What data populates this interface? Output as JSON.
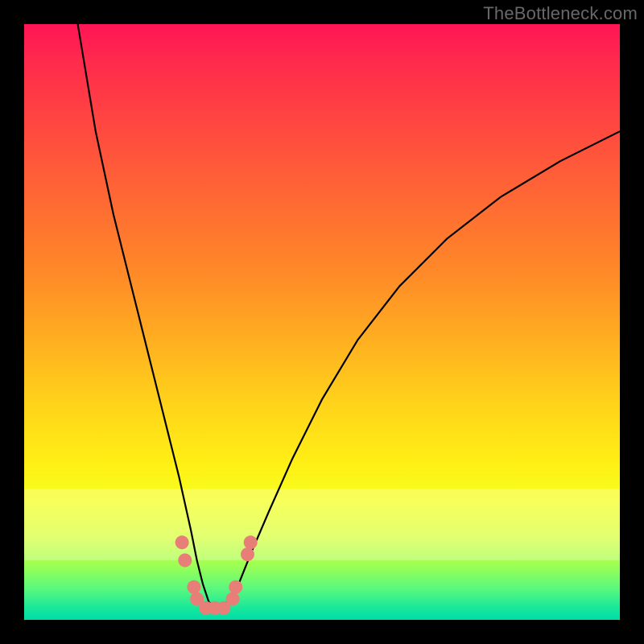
{
  "watermark": "TheBottleneck.com",
  "colors": {
    "frame": "#000000",
    "gradient_top": "#ff1555",
    "gradient_mid1": "#ff8a28",
    "gradient_mid2": "#fff015",
    "gradient_bottom": "#00dca9",
    "curve_stroke": "#000000",
    "marker_fill": "#e77f78",
    "watermark_text": "#686868"
  },
  "chart_data": {
    "type": "line",
    "title": "",
    "xlabel": "",
    "ylabel": "",
    "xlim": [
      0,
      100
    ],
    "ylim": [
      0,
      100
    ],
    "series": [
      {
        "name": "bottleneck-curve",
        "x": [
          9,
          12,
          15,
          18,
          20,
          22,
          24,
          26,
          28,
          29,
          30,
          31,
          32,
          33,
          34,
          36,
          38,
          41,
          45,
          50,
          56,
          63,
          71,
          80,
          90,
          100
        ],
        "y": [
          100,
          82,
          68,
          56,
          48,
          40,
          32,
          24,
          15,
          10,
          6,
          3,
          2,
          2,
          3,
          6,
          11,
          18,
          27,
          37,
          47,
          56,
          64,
          71,
          77,
          82
        ]
      }
    ],
    "markers": [
      {
        "x": 26.5,
        "y": 13
      },
      {
        "x": 27.0,
        "y": 10
      },
      {
        "x": 28.5,
        "y": 5.5
      },
      {
        "x": 29.0,
        "y": 3.5
      },
      {
        "x": 30.5,
        "y": 2.0
      },
      {
        "x": 32.0,
        "y": 2.0
      },
      {
        "x": 33.5,
        "y": 2.0
      },
      {
        "x": 35.0,
        "y": 3.5
      },
      {
        "x": 35.5,
        "y": 5.5
      },
      {
        "x": 37.5,
        "y": 11
      },
      {
        "x": 38.0,
        "y": 13
      }
    ],
    "pale_band_y": [
      78,
      90
    ]
  }
}
